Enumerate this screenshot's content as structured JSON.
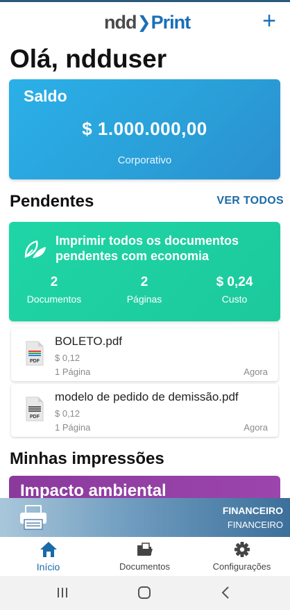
{
  "app": {
    "logo_left": "ndd",
    "logo_right": "Print"
  },
  "greeting": "Olá, ndduser",
  "balance": {
    "title": "Saldo",
    "value": "$ 1.000.000,00",
    "type": "Corporativo"
  },
  "pending": {
    "title": "Pendentes",
    "see_all": "VER TODOS",
    "eco": {
      "text": "Imprimir todos os documentos pendentes com economia",
      "documents_value": "2",
      "documents_label": "Documentos",
      "pages_value": "2",
      "pages_label": "Páginas",
      "cost_value": "$ 0,24",
      "cost_label": "Custo"
    },
    "documents": [
      {
        "name": "BOLETO.pdf",
        "price": "$ 0,12",
        "pages": "1 Página",
        "time": "Agora",
        "icon": "pdf-color-icon"
      },
      {
        "name": "modelo de pedido de demissão.pdf",
        "price": "$ 0,12",
        "pages": "1 Página",
        "time": "Agora",
        "icon": "pdf-gray-icon"
      }
    ]
  },
  "my_prints": {
    "title": "Minhas impressões",
    "impact_title": "Impacto ambiental"
  },
  "printer": {
    "name": "FINANCEIRO",
    "subtitle": "FINANCEIRO"
  },
  "nav": [
    {
      "label": "Início",
      "icon": "home-icon",
      "active": true
    },
    {
      "label": "Documentos",
      "icon": "folder-icon",
      "active": false
    },
    {
      "label": "Configurações",
      "icon": "gear-icon",
      "active": false
    }
  ],
  "colors": {
    "accent": "#1a6aa8",
    "balance_card": "#2aa6e0",
    "eco_card": "#1fd2a3",
    "impact_card": "#9240a6"
  }
}
